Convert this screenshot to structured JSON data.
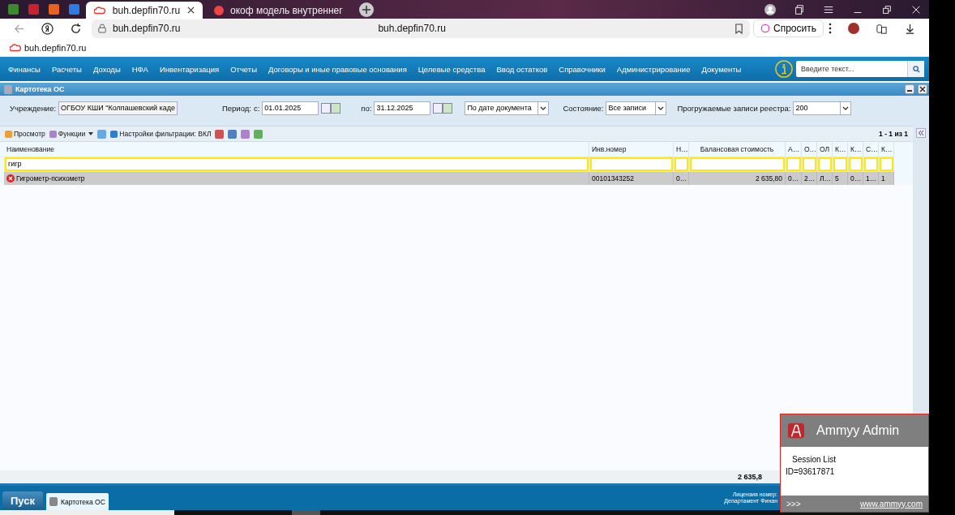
{
  "browser": {
    "tabs": [
      {
        "title": "buh.depfin70.ru",
        "selected": true
      },
      {
        "title": "окоф модель внутреннег",
        "selected": false
      }
    ],
    "address": {
      "url": "buh.depfin70.ru",
      "center_title": "buh.depfin70.ru"
    },
    "ask_button": "Спросить",
    "bookmarks": [
      "buh.depfin70.ru"
    ]
  },
  "menu": [
    "Финансы",
    "Расчеты",
    "Доходы",
    "НФА",
    "Инвентаризация",
    "Отчеты",
    "Договоры и иные правовые основания",
    "Целевые средства",
    "Ввод остатков",
    "Справочники",
    "Администрирование",
    "Документы"
  ],
  "search": {
    "placeholder": "Введите текст..."
  },
  "window": {
    "title": "Картотека ОС"
  },
  "filters": {
    "institution_label": "Учреждение:",
    "institution": "ОГБОУ КШИ \"Колпашевский каде",
    "period_label": "Период:",
    "from_label": "с:",
    "from": "01.01.2025",
    "to_label": "по:",
    "to": "31.12.2025",
    "date_mode": "По дате документа",
    "state_label": "Состояние:",
    "state": "Все записи",
    "load_label": "Прогружаемые записи реестра:",
    "load": "200"
  },
  "toolbar": {
    "view": "Просмотр",
    "functions": "Функции",
    "filter_settings": "Настройки фильтрации: ВКЛ",
    "pager": "1 - 1 из 1"
  },
  "table": {
    "columns": [
      {
        "label": "Наименование",
        "filter": "гигр"
      },
      {
        "label": "Инв.номер"
      },
      {
        "label": "Н…"
      },
      {
        "label": "Балансовая стоимость"
      },
      {
        "label": "А…"
      },
      {
        "label": "О…"
      },
      {
        "label": "ОЛ"
      },
      {
        "label": "К…"
      },
      {
        "label": "К…"
      },
      {
        "label": "С…"
      },
      {
        "label": "К…"
      }
    ],
    "rows": [
      {
        "selected": true,
        "cells": [
          "Гигрометр-психометр",
          "00101343252",
          "0…",
          "2 635,80",
          "0…",
          "2…",
          "Л…",
          "5",
          "0…",
          "1…",
          "1"
        ]
      }
    ],
    "total": "2 635,8"
  },
  "taskbar": {
    "start": "Пуск",
    "tasks": [
      {
        "title": "Картотека ОС",
        "selected": true
      }
    ],
    "license": "Лицензия номер:",
    "department": "Департамент Финан"
  },
  "ammyy": {
    "title": "Ammyy Admin",
    "session": "Session List",
    "id": "ID=93617871",
    "more": ">>>",
    "link": "www.ammyy.com"
  }
}
